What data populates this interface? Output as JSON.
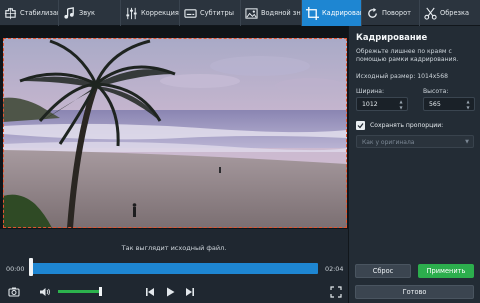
{
  "toolbar": {
    "tabs": [
      {
        "label": "Стабилизация",
        "icon": "stabilize-icon"
      },
      {
        "label": "Звук",
        "icon": "music-note-icon"
      },
      {
        "label": "Коррекция",
        "icon": "adjust-sliders-icon"
      },
      {
        "label": "Субтитры",
        "icon": "subtitles-icon"
      },
      {
        "label": "Водяной знак",
        "icon": "watermark-icon"
      },
      {
        "label": "Кадрирование",
        "icon": "crop-icon",
        "active": true
      },
      {
        "label": "Поворот",
        "icon": "rotate-icon"
      },
      {
        "label": "Обрезка",
        "icon": "scissors-icon"
      }
    ]
  },
  "preview": {
    "info_text": "Так выглядит исходный файл.",
    "time_start": "00:00",
    "time_end": "02:04",
    "playhead_fraction": 0.0,
    "volume_fraction": 0.95
  },
  "panel": {
    "title": "Кадрирование",
    "description": "Обрежьте лишнее по краям с помощью рамки кадрирования.",
    "original_size": "Исходный размер: 1014x568",
    "width_label": "Ширина:",
    "width_value": "1012",
    "height_label": "Высота:",
    "height_value": "565",
    "keep_ratio_label": "Сохранять пропорции:",
    "keep_ratio_checked": true,
    "ratio_placeholder": "Как у оригинала",
    "reset_label": "Сброс",
    "apply_label": "Применить",
    "done_label": "Готово"
  },
  "colors": {
    "accent": "#1e86d2",
    "apply": "#2cae4d",
    "crop_border": "#e2552f",
    "panel_bg": "#232c35"
  }
}
